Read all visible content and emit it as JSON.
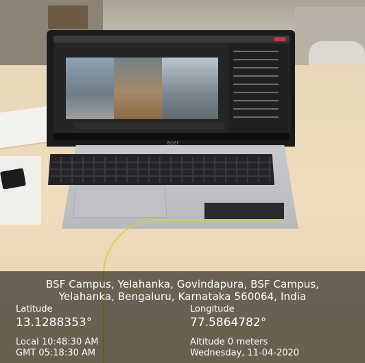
{
  "geotag": {
    "address_line1": "BSF Campus, Yelahanka, Govindapura, BSF Campus,",
    "address_line2": "Yelahanka, Bengaluru, Karnataka 560064, India",
    "latitude_label": "Latitude",
    "latitude_value": "13.1288353°",
    "longitude_label": "Longitude",
    "longitude_value": "77.5864782°",
    "local_time": "Local 10:48:30 AM",
    "gmt_time": "GMT 05:18:30 AM",
    "altitude": "Altitude 0 meters",
    "date": "Wednesday, 11-04-2020"
  },
  "laptop": {
    "brand": "acer"
  },
  "colors": {
    "overlay": "#00000090",
    "cable": "#d7d23a",
    "call_end_red": "#c4314b"
  }
}
